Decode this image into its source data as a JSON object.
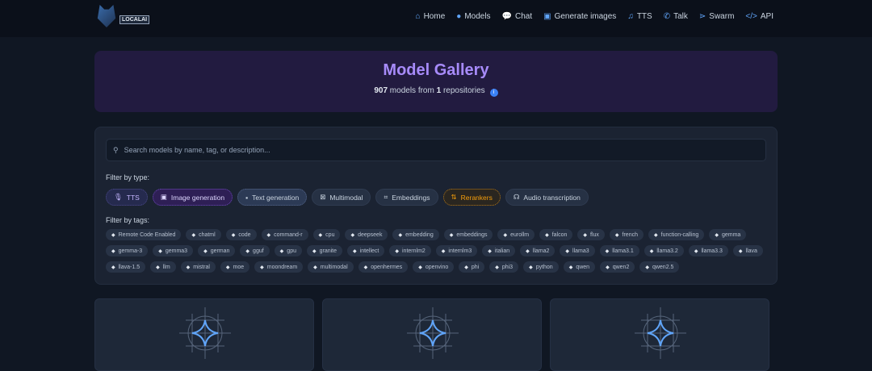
{
  "brand": {
    "logo_text": "LOCALAI"
  },
  "nav": [
    {
      "label": "Home",
      "icon": "home-icon",
      "glyph": "⌂"
    },
    {
      "label": "Models",
      "icon": "brain-icon",
      "glyph": "●"
    },
    {
      "label": "Chat",
      "icon": "chat-icon",
      "glyph": "💬"
    },
    {
      "label": "Generate images",
      "icon": "image-icon",
      "glyph": "▣"
    },
    {
      "label": "TTS",
      "icon": "music-icon",
      "glyph": "♫"
    },
    {
      "label": "Talk",
      "icon": "phone-icon",
      "glyph": "✆"
    },
    {
      "label": "Swarm",
      "icon": "network-icon",
      "glyph": "⋗"
    },
    {
      "label": "API",
      "icon": "code-icon",
      "glyph": "</>"
    }
  ],
  "hero": {
    "title": "Model Gallery",
    "count": "907",
    "count_text": " models from ",
    "repos": "1",
    "repos_text": " repositories"
  },
  "search": {
    "placeholder": "Search models by name, tag, or description..."
  },
  "filter_type_label": "Filter by type:",
  "filter_tags_label": "Filter by tags:",
  "types": [
    {
      "label": "TTS",
      "glyph": "🎙",
      "style": "tts"
    },
    {
      "label": "Image generation",
      "glyph": "▣",
      "style": "img"
    },
    {
      "label": "Text generation",
      "glyph": "▪",
      "style": "txt"
    },
    {
      "label": "Multimodal",
      "glyph": "⊠",
      "style": ""
    },
    {
      "label": "Embeddings",
      "glyph": "⌗",
      "style": ""
    },
    {
      "label": "Rerankers",
      "glyph": "⇅",
      "style": "rr"
    },
    {
      "label": "Audio transcription",
      "glyph": "☊",
      "style": ""
    }
  ],
  "tags": [
    "Remote Code Enabled",
    "chatml",
    "code",
    "command-r",
    "cpu",
    "deepseek",
    "embedding",
    "embeddings",
    "eurollm",
    "falcon",
    "flux",
    "french",
    "function-calling",
    "gemma",
    "gemma-3",
    "gemma3",
    "german",
    "gguf",
    "gpu",
    "granite",
    "intellect",
    "internlm2",
    "internlm3",
    "italian",
    "llama2",
    "llama3",
    "llama3.1",
    "llama3.2",
    "llama3.3",
    "llava",
    "llava-1.5",
    "llm",
    "mistral",
    "moe",
    "moondream",
    "multimodal",
    "openhermes",
    "openvino",
    "phi",
    "phi3",
    "python",
    "qwen",
    "qwen2",
    "qwen2.5"
  ],
  "colors": {
    "accent": "#a78bfa",
    "link": "#60a5fa",
    "reranker": "#f59e0b"
  }
}
